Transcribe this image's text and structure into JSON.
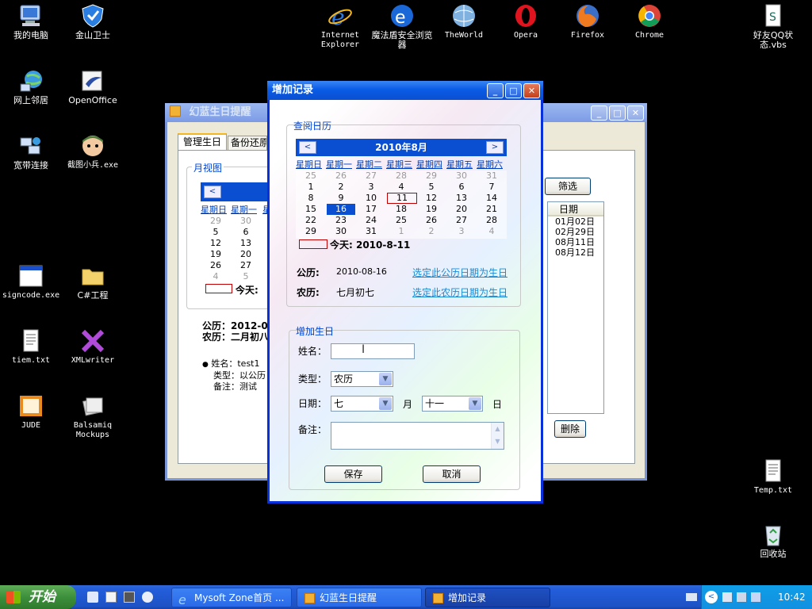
{
  "desktop_icons": [
    {
      "label": "我的电脑",
      "icon": "my-computer-icon"
    },
    {
      "label": "金山卫士",
      "icon": "shield-icon"
    },
    {
      "label": "网上邻居",
      "icon": "network-icon"
    },
    {
      "label": "OpenOffice",
      "icon": "openoffice-icon"
    },
    {
      "label": "宽带连接",
      "icon": "broadband-icon"
    },
    {
      "label": "截图小兵.exe",
      "icon": "screenshot-tool-icon"
    },
    {
      "label": "signcode.exe",
      "icon": "app-window-icon"
    },
    {
      "label": "C#工程",
      "icon": "folder-icon"
    },
    {
      "label": "tiem.txt",
      "icon": "text-file-icon"
    },
    {
      "label": "XMLwriter",
      "icon": "xmlwriter-icon"
    },
    {
      "label": "JUDE",
      "icon": "jude-icon"
    },
    {
      "label": "Balsamiq Mockups",
      "icon": "balsamiq-icon"
    },
    {
      "label": "Internet Explorer",
      "icon": "ie-icon"
    },
    {
      "label": "魔法盾安全浏览器",
      "icon": "browser-icon"
    },
    {
      "label": "TheWorld",
      "icon": "theworld-icon"
    },
    {
      "label": "Opera",
      "icon": "opera-icon"
    },
    {
      "label": "Firefox",
      "icon": "firefox-icon"
    },
    {
      "label": "Chrome",
      "icon": "chrome-icon"
    },
    {
      "label": "好友QQ状态.vbs",
      "icon": "script-file-icon"
    },
    {
      "label": "Temp.txt",
      "icon": "text-file-icon"
    },
    {
      "label": "回收站",
      "icon": "recycle-bin-icon"
    }
  ],
  "back_window": {
    "title": "幻蓝生日提醒",
    "tabs": [
      "管理生日",
      "备份还原"
    ],
    "month_view_label": "月视图",
    "weekdays_partial": [
      "星期日",
      "星期一",
      "星"
    ],
    "day_rows": [
      [
        "29",
        "30",
        ""
      ],
      [
        "5",
        "6",
        ""
      ],
      [
        "12",
        "13",
        ""
      ],
      [
        "19",
        "20",
        ""
      ],
      [
        "26",
        "27",
        ""
      ],
      [
        "4",
        "5",
        ""
      ]
    ],
    "today_label": "今天:",
    "solar_line": "公历：2012-02-",
    "lunar_line": "农历：二月初八",
    "info": {
      "name": "姓名：test1",
      "type": "类型：以公历",
      "note": "备注：测试"
    },
    "filter_button": "筛选",
    "date_column": "日期",
    "date_list": [
      "01月02日",
      "02月29日",
      "08月11日",
      "08月12日"
    ],
    "delete_button": "删除"
  },
  "dialog": {
    "title": "增加记录",
    "calendar_group": "查阅日历",
    "month_title": "2010年8月",
    "prev": "<",
    "next": ">",
    "weekdays": [
      "星期日",
      "星期一",
      "星期二",
      "星期三",
      "星期四",
      "星期五",
      "星期六"
    ],
    "weeks": [
      [
        "25",
        "26",
        "27",
        "28",
        "29",
        "30",
        "31"
      ],
      [
        "1",
        "2",
        "3",
        "4",
        "5",
        "6",
        "7"
      ],
      [
        "8",
        "9",
        "10",
        "11",
        "12",
        "13",
        "14"
      ],
      [
        "15",
        "16",
        "17",
        "18",
        "19",
        "20",
        "21"
      ],
      [
        "22",
        "23",
        "24",
        "25",
        "26",
        "27",
        "28"
      ],
      [
        "29",
        "30",
        "31",
        "1",
        "2",
        "3",
        "4"
      ]
    ],
    "today_text": "今天: 2010-8-11",
    "solar_label": "公历:",
    "solar_value": "2010-08-16",
    "solar_link": "选定此公历日期为生日",
    "lunar_label": "农历:",
    "lunar_value": "七月初七",
    "lunar_link": "选定此农历日期为生日",
    "add_group": "增加生日",
    "name_label": "姓名：",
    "name_value": "",
    "type_label": "类型：",
    "type_value": "农历",
    "date_label": "日期：",
    "month_value": "七",
    "month_unit": "月",
    "day_value": "十一",
    "day_unit": "日",
    "note_label": "备注：",
    "note_value": "",
    "save_button": "保存",
    "cancel_button": "取消"
  },
  "taskbar": {
    "start": "开始",
    "items": [
      "Mysoft Zone首页 ...",
      "幻蓝生日提醒",
      "增加记录"
    ],
    "clock": "10:42"
  },
  "colors": {
    "title_blue": "#0a4fd1",
    "link": "#0040c0",
    "today_border": "#c00000"
  }
}
